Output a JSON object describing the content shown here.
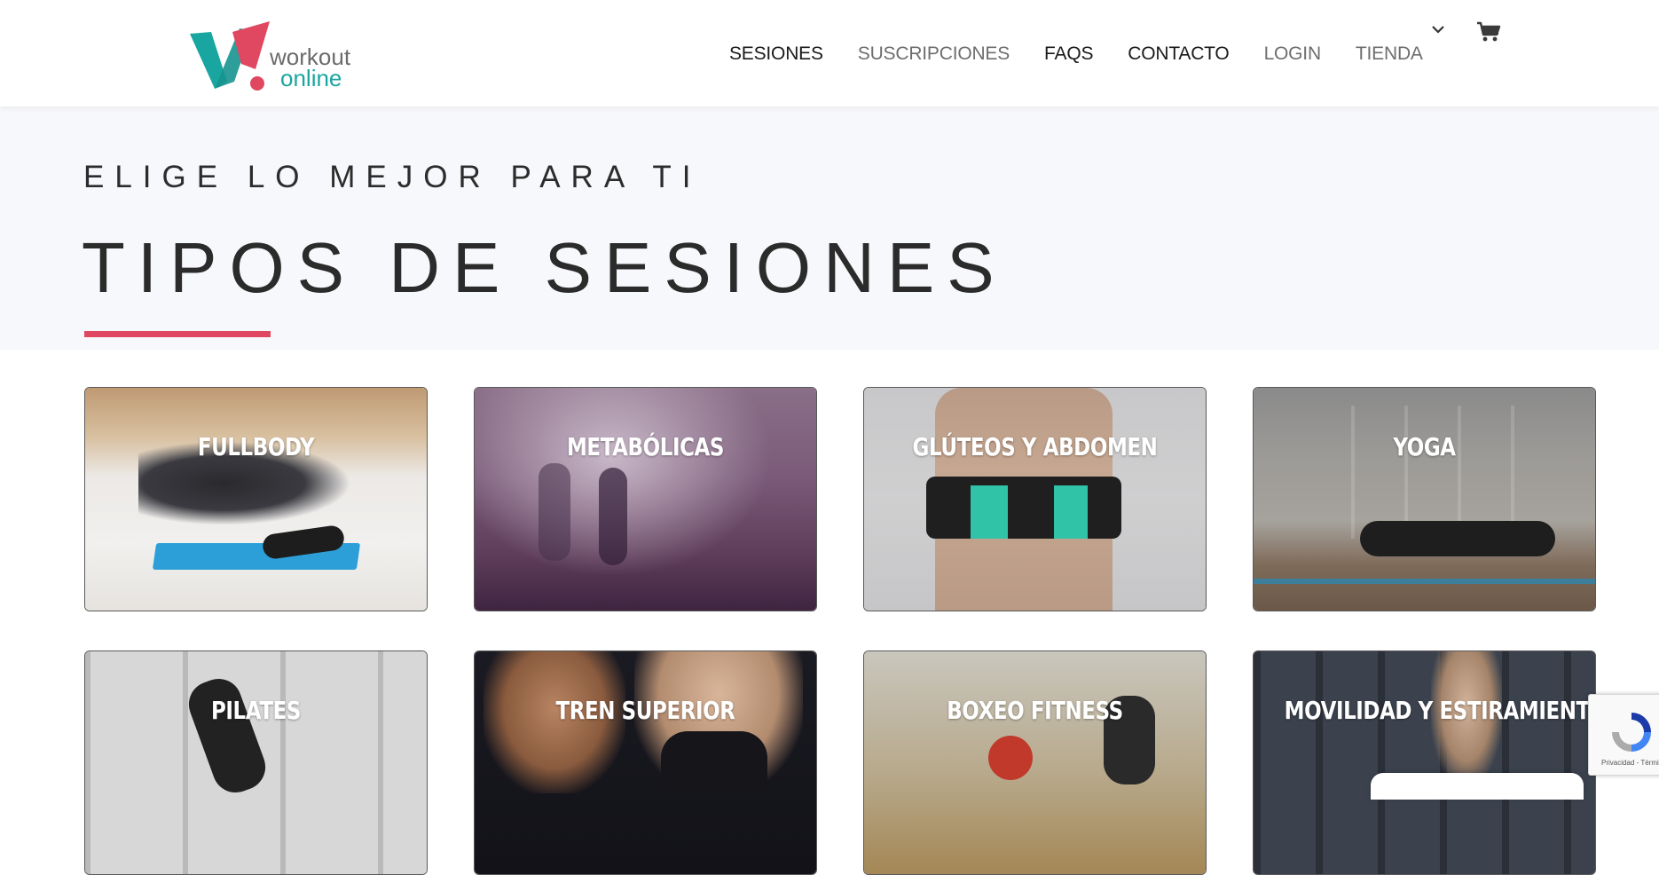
{
  "brand": {
    "logo_line1": "workout",
    "logo_line2": "online",
    "colors": {
      "pink": "#e04760",
      "teal": "#1aa6a0"
    }
  },
  "nav": {
    "items": [
      {
        "label": "SESIONES",
        "style": "dark"
      },
      {
        "label": "SUSCRIPCIONES",
        "style": "grey"
      },
      {
        "label": "FAQS",
        "style": "dark"
      },
      {
        "label": "CONTACTO",
        "style": "dark"
      },
      {
        "label": "LOGIN",
        "style": "grey"
      },
      {
        "label": "TIENDA",
        "style": "grey"
      }
    ],
    "dropdown_icon": "chevron-down-icon",
    "cart_icon": "cart-icon"
  },
  "hero": {
    "eyebrow": "ELIGE LO MEJOR PARA TI",
    "title": "TIPOS DE SESIONES",
    "accent_color": "#e04760"
  },
  "sessions": [
    {
      "label": "FULLBODY"
    },
    {
      "label": "METABÓLICAS"
    },
    {
      "label": "GLÚTEOS Y ABDOMEN"
    },
    {
      "label": "YOGA"
    },
    {
      "label": "PILATES"
    },
    {
      "label": "TREN SUPERIOR"
    },
    {
      "label": "BOXEO FITNESS"
    },
    {
      "label": "MOVILIDAD Y ESTIRAMIENTO"
    }
  ],
  "recaptcha": {
    "footer": "Privacidad - Términos"
  }
}
